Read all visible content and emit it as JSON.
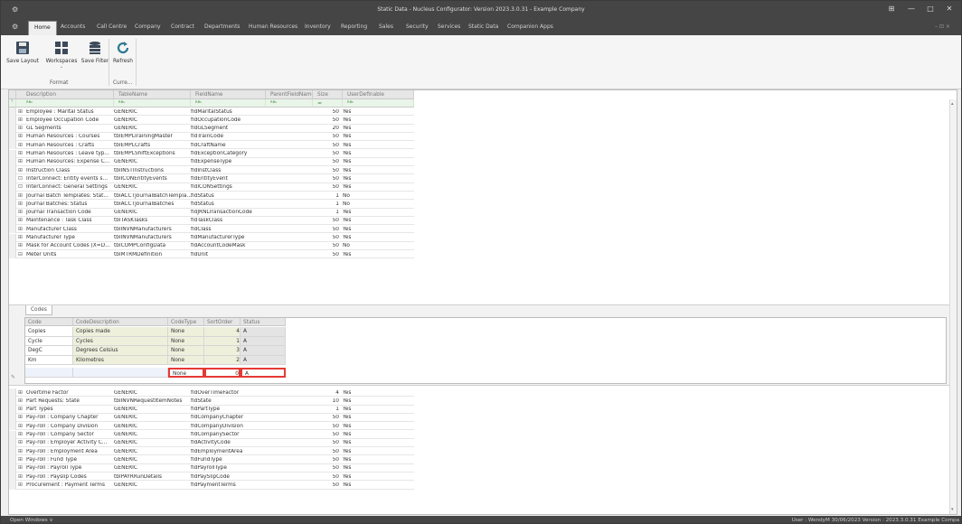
{
  "window": {
    "title": "Static Data - Nucleus Configurator: Version 2023.3.0.31 - Example Company",
    "controls": [
      "⊞",
      "—",
      "□",
      "✕"
    ]
  },
  "menu": {
    "tabs": [
      "Home",
      "Accounts",
      "Call Centre",
      "Company",
      "Contract",
      "Departments",
      "Human Resources",
      "Inventory",
      "Reporting",
      "Sales",
      "Security",
      "Services",
      "Static Data",
      "Companion Apps"
    ],
    "right_controls": "– ⊡ ×"
  },
  "ribbon": {
    "buttons": [
      {
        "label": "Save Layout",
        "icon": "save-icon"
      },
      {
        "label": "Workspaces",
        "icon": "workspaces-icon"
      },
      {
        "label": "Save Filter",
        "icon": "filter-stack-icon"
      },
      {
        "label": "Refresh",
        "icon": "refresh-icon"
      }
    ],
    "groups": [
      "Format",
      "Curre..."
    ]
  },
  "grid": {
    "columns": [
      "Description",
      "TableName",
      "FieldName",
      "ParentFieldName",
      "Size",
      "UserDefinable"
    ],
    "filter_symbols": [
      "ᴿᴮᶜ",
      "ᴿᴮᶜ",
      "ᴿᴮᶜ",
      "ᴿᴮᶜ",
      "=",
      "ᴿᴮᶜ"
    ],
    "rows_top": [
      {
        "exp": "⊞",
        "description": "Employee : Marital Status",
        "table": "GENERIC",
        "field": "fldMaritalStatus",
        "size": "50",
        "ud": "Yes"
      },
      {
        "exp": "⊞",
        "description": "Employee Occupation Code",
        "table": "GENERIC",
        "field": "fldOccupationCode",
        "size": "50",
        "ud": "Yes"
      },
      {
        "exp": "⊞",
        "description": "GL Segments",
        "table": "GENERIC",
        "field": "fldGLSegment",
        "size": "20",
        "ud": "Yes"
      },
      {
        "exp": "⊞",
        "description": "Human Resources : Courses",
        "table": "tblEMPLTrainingMaster",
        "field": "fldTrainCode",
        "size": "50",
        "ud": "Yes"
      },
      {
        "exp": "⊞",
        "description": "Human Resources : Crafts",
        "table": "tblEMPLCrafts",
        "field": "fldCraftName",
        "size": "50",
        "ud": "Yes"
      },
      {
        "exp": "⊞",
        "description": "Human Resources : Leave typ...",
        "table": "tblEMPLShiftExceptions",
        "field": "fldExceptionCategory",
        "size": "50",
        "ud": "Yes"
      },
      {
        "exp": "⊞",
        "description": "Human Resources: Expense C...",
        "table": "GENERIC",
        "field": "fldExpenseType",
        "size": "50",
        "ud": "Yes"
      },
      {
        "exp": "⊞",
        "description": "Instruction Class",
        "table": "tblINSTInstructions",
        "field": "fldInstClass",
        "size": "50",
        "ud": "Yes"
      },
      {
        "exp": "⊡",
        "description": "InterConnect: Entity events s...",
        "table": "tblICONEntityEvents",
        "field": "fldEntityEvent",
        "size": "50",
        "ud": "Yes"
      },
      {
        "exp": "⊡",
        "description": "InterConnect: General Settings",
        "table": "GENERIC",
        "field": "fldICONSettings",
        "size": "50",
        "ud": "Yes"
      },
      {
        "exp": "⊞",
        "description": "Journal Batch Templates: Stat...",
        "table": "tblACCTJournalBatchTempla...",
        "field": "fldStatus",
        "size": "1",
        "ud": "No"
      },
      {
        "exp": "⊞",
        "description": "Journal Batches: Status",
        "table": "tblACCTJournalBatches",
        "field": "fldStatus",
        "size": "1",
        "ud": "No"
      },
      {
        "exp": "⊞",
        "description": "Journal Transaction Code",
        "table": "GENERIC",
        "field": "fldJRNLTransactionCode",
        "size": "1",
        "ud": "Yes"
      },
      {
        "exp": "⊞",
        "description": "Maintenance : Task Class",
        "table": "tblTASKTasks",
        "field": "fldTaskClass",
        "size": "50",
        "ud": "Yes"
      },
      {
        "exp": "⊞",
        "description": "Manufacturer Class",
        "table": "tblINVNManufacturers",
        "field": "fldClass",
        "size": "50",
        "ud": "Yes"
      },
      {
        "exp": "⊞",
        "description": "Manufacturer Type",
        "table": "tblINVNManufacturers",
        "field": "fldManufacturerType",
        "size": "50",
        "ud": "Yes"
      },
      {
        "exp": "⊞",
        "description": "Mask for Account Codes (X=D...",
        "table": "tblCOMPConfigData",
        "field": "fldAccountCodeMask",
        "size": "50",
        "ud": "No"
      },
      {
        "exp": "⊟",
        "description": "Meter Units",
        "table": "tblMTRMDefinition",
        "field": "fldUnit",
        "size": "50",
        "ud": "Yes"
      }
    ],
    "rows_bottom": [
      {
        "exp": "⊞",
        "description": "Overtime Factor",
        "table": "GENERIC",
        "field": "fldOverTimeFactor",
        "size": "4",
        "ud": "Yes"
      },
      {
        "exp": "⊞",
        "description": "Part Requests: State",
        "table": "tblINVNRequestItemNotes",
        "field": "fldState",
        "size": "10",
        "ud": "Yes"
      },
      {
        "exp": "⊞",
        "description": "Part Types",
        "table": "GENERIC",
        "field": "fldPartType",
        "size": "1",
        "ud": "Yes"
      },
      {
        "exp": "⊞",
        "description": "Pay-roll : Company Chapter",
        "table": "GENERIC",
        "field": "fldCompanyChapter",
        "size": "50",
        "ud": "Yes"
      },
      {
        "exp": "⊞",
        "description": "Pay-roll : Company Division",
        "table": "GENERIC",
        "field": "fldCompanyDivision",
        "size": "50",
        "ud": "Yes"
      },
      {
        "exp": "⊞",
        "description": "Pay-roll : Company Sector",
        "table": "GENERIC",
        "field": "fldCompanySector",
        "size": "50",
        "ud": "Yes"
      },
      {
        "exp": "⊞",
        "description": "Pay-roll : Employer Activity C...",
        "table": "GENERIC",
        "field": "fldActivityCode",
        "size": "50",
        "ud": "Yes"
      },
      {
        "exp": "⊞",
        "description": "Pay-roll : Employment Area",
        "table": "GENERIC",
        "field": "fldEmploymentArea",
        "size": "50",
        "ud": "Yes"
      },
      {
        "exp": "⊞",
        "description": "Pay-roll : Fund Type",
        "table": "GENERIC",
        "field": "fldFundType",
        "size": "50",
        "ud": "Yes"
      },
      {
        "exp": "⊞",
        "description": "Pay-roll : Payroll Type",
        "table": "GENERIC",
        "field": "fldPayrollType",
        "size": "50",
        "ud": "Yes"
      },
      {
        "exp": "⊞",
        "description": "Pay-roll : Payslip Codes",
        "table": "tblPAYRRunDetails",
        "field": "fldPaySlipCode",
        "size": "50",
        "ud": "Yes"
      },
      {
        "exp": "⊞",
        "description": "Procurement : Payment Terms",
        "table": "GENERIC",
        "field": "fldPaymentTerms",
        "size": "50",
        "ud": "Yes"
      }
    ]
  },
  "detail": {
    "tab": "Codes",
    "columns": [
      "Code",
      "CodeDescription",
      "CodeType",
      "SortOrder",
      "Status"
    ],
    "rows": [
      {
        "code": "Copies",
        "desc": "Copies made",
        "type": "None",
        "sort": "4",
        "status": "A"
      },
      {
        "code": "Cycle",
        "desc": "Cycles",
        "type": "None",
        "sort": "1",
        "status": "A"
      },
      {
        "code": "DegC",
        "desc": "Degrees Celsius",
        "type": "None",
        "sort": "3",
        "status": "A"
      },
      {
        "code": "Km",
        "desc": "Kilometres",
        "type": "None",
        "sort": "2",
        "status": "A"
      }
    ],
    "new_row": {
      "code": "",
      "desc": "",
      "type": "None",
      "sort": "0",
      "status": "A"
    }
  },
  "status": {
    "left": "Open Windows ∨",
    "right": "User : WendyM  30/06/2023  Version : 2023.3.0.31  Example Compa"
  },
  "colors": {
    "chrome": "#454545",
    "highlight": "#e53935",
    "filter": "#3a8a3a"
  }
}
